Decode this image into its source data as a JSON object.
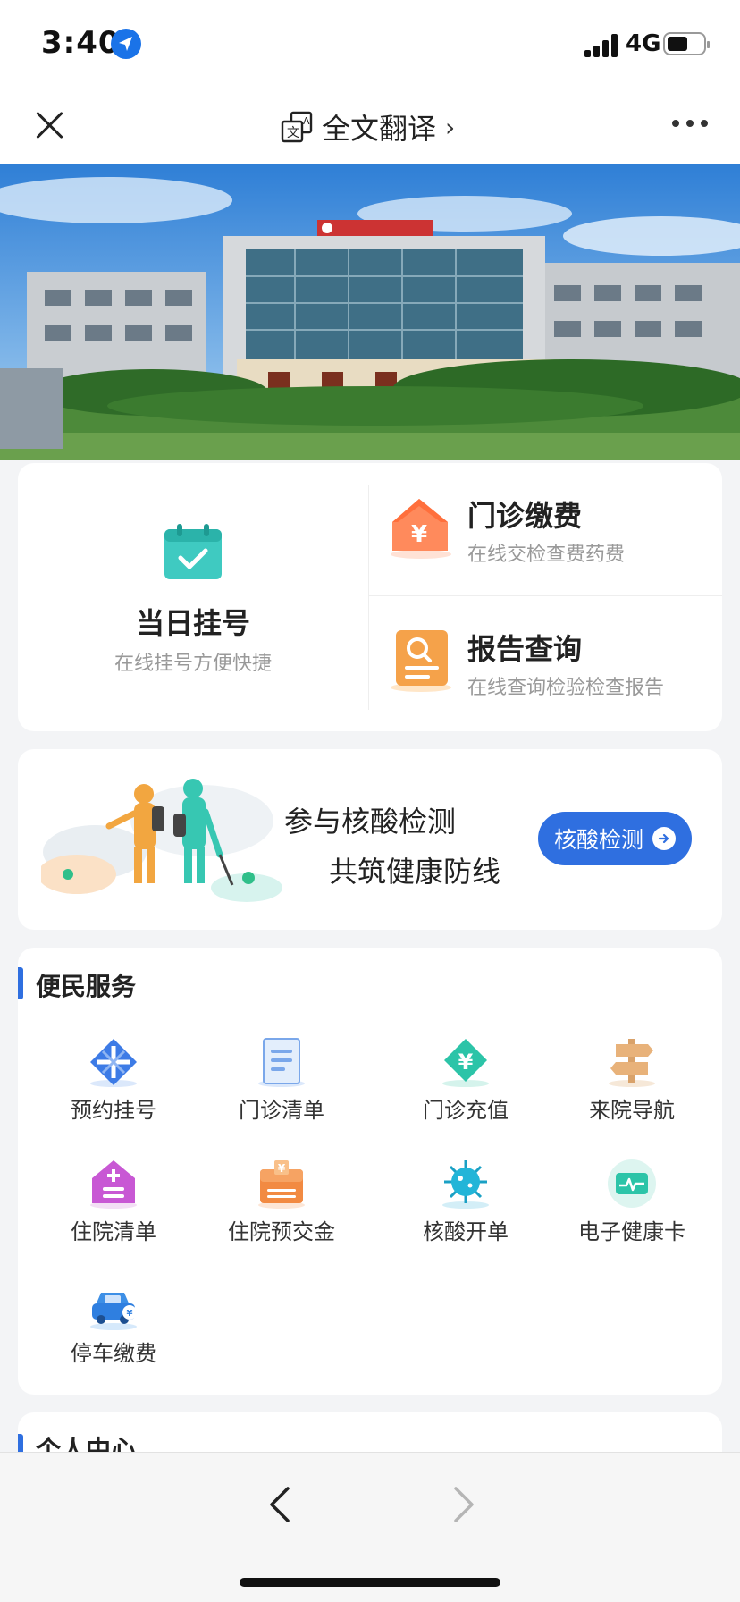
{
  "status_bar": {
    "time": "3:40",
    "network": "4G"
  },
  "nav": {
    "translate_label": "全文翻译"
  },
  "registration": {
    "title": "当日挂号",
    "subtitle": "在线挂号方便快捷"
  },
  "outpatient_payment": {
    "title": "门诊缴费",
    "subtitle": "在线交检查费药费"
  },
  "report_query": {
    "title": "报告查询",
    "subtitle": "在线查询检验检查报告"
  },
  "nucleic": {
    "line1": "参与核酸检测",
    "line2": "共筑健康防线",
    "button_label": "核酸检测"
  },
  "convenience": {
    "title": "便民服务",
    "items": [
      {
        "label": "预约挂号",
        "icon": "appointment-icon"
      },
      {
        "label": "门诊清单",
        "icon": "list-doc-icon"
      },
      {
        "label": "门诊充值",
        "icon": "recharge-icon"
      },
      {
        "label": "来院导航",
        "icon": "signpost-icon"
      },
      {
        "label": "住院清单",
        "icon": "hospital-house-icon"
      },
      {
        "label": "住院预交金",
        "icon": "deposit-box-icon"
      },
      {
        "label": "核酸开单",
        "icon": "virus-icon"
      },
      {
        "label": "电子健康卡",
        "icon": "health-card-icon"
      },
      {
        "label": "停车缴费",
        "icon": "car-icon"
      }
    ]
  },
  "personal": {
    "title": "个人中心"
  },
  "colors": {
    "accent": "#2f6fe0",
    "teal": "#39c6c0",
    "orange": "#ff8a5c",
    "amber": "#f5a24a"
  }
}
